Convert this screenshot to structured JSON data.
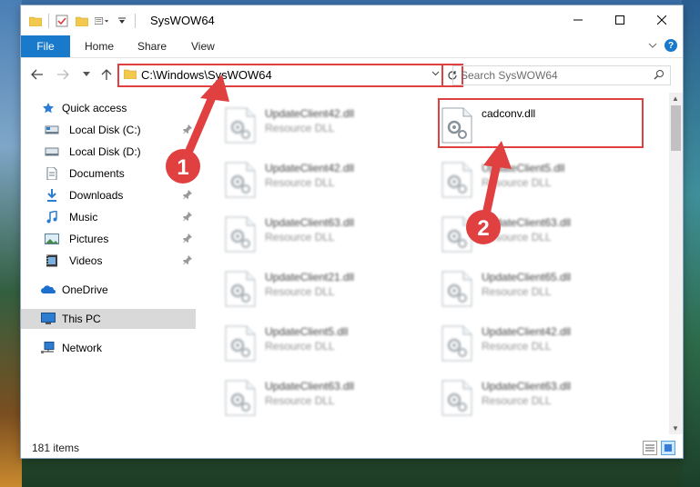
{
  "window": {
    "title": "SysWOW64",
    "ribbon_tabs": [
      "File",
      "Home",
      "Share",
      "View"
    ]
  },
  "nav": {
    "address": "C:\\Windows\\SysWOW64",
    "search_placeholder": "Search SysWOW64"
  },
  "sidebar": {
    "quick_access": "Quick access",
    "items": [
      {
        "label": "Local Disk (C:)",
        "icon": "drive-icon",
        "pinned": true
      },
      {
        "label": "Local Disk (D:)",
        "icon": "drive-icon",
        "pinned": false
      },
      {
        "label": "Documents",
        "icon": "documents-icon",
        "pinned": true
      },
      {
        "label": "Downloads",
        "icon": "downloads-icon",
        "pinned": true
      },
      {
        "label": "Music",
        "icon": "music-icon",
        "pinned": true
      },
      {
        "label": "Pictures",
        "icon": "pictures-icon",
        "pinned": true
      },
      {
        "label": "Videos",
        "icon": "videos-icon",
        "pinned": true
      }
    ],
    "onedrive": "OneDrive",
    "this_pc": "This PC",
    "network": "Network"
  },
  "files": {
    "left": [
      {
        "name": "UpdateClient42.dll",
        "type": "Resource DLL"
      },
      {
        "name": "UpdateClient42.dll",
        "type": "Resource DLL"
      },
      {
        "name": "UpdateClient63.dll",
        "type": "Resource DLL"
      },
      {
        "name": "UpdateClient21.dll",
        "type": "Resource DLL"
      },
      {
        "name": "UpdateClient5.dll",
        "type": "Resource DLL"
      },
      {
        "name": "UpdateClient63.dll",
        "type": "Resource DLL"
      }
    ],
    "right": [
      {
        "name": "cadconv.dll",
        "type": ""
      },
      {
        "name": "UpdateClient5.dll",
        "type": "Resource DLL"
      },
      {
        "name": "UpdateClient63.dll",
        "type": "Resource DLL"
      },
      {
        "name": "UpdateClient65.dll",
        "type": "Resource DLL"
      },
      {
        "name": "UpdateClient42.dll",
        "type": "Resource DLL"
      },
      {
        "name": "UpdateClient63.dll",
        "type": "Resource DLL"
      }
    ]
  },
  "status": {
    "item_count": "181 items"
  },
  "annotations": {
    "step1": "1",
    "step2": "2",
    "color": "#e04040"
  }
}
